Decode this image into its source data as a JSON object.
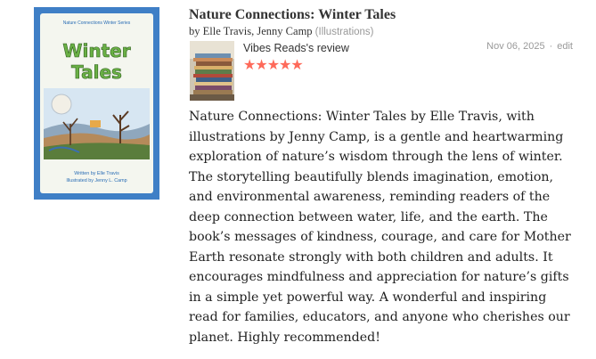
{
  "cover": {
    "series": "Nature Connections Winter Series",
    "title_line1": "Winter",
    "title_line2": "Tales",
    "credit_written": "Written by Elle Travis",
    "credit_illustrated": "Illustrated by Jenny L. Camp"
  },
  "book": {
    "title": "Nature Connections: Winter Tales",
    "authors_prefix": "by Elle Travis, Jenny Camp",
    "illustrator_role": "(Illustrations)"
  },
  "review": {
    "reviewer_label": "Vibes Reads's review",
    "date": "Nov 06, 2025",
    "separator": "·",
    "edit_label": "edit",
    "rating": 5,
    "star_glyph": "★",
    "star_color": "#fe6a5a",
    "body": "Nature Connections: Winter Tales by Elle Travis, with illustrations by Jenny Camp, is a gentle and heartwarming exploration of nature’s wisdom through the lens of winter. The storytelling beautifully blends imagination, emotion, and environmental awareness, reminding readers of the deep connection between water, life, and the earth. The book’s messages of kindness, courage, and care for Mother Earth resonate strongly with both children and adults. It encourages mindfulness and appreciation for nature’s gifts in a simple yet powerful way. A wonderful and inspiring read for families, educators, and anyone who cherishes our planet. Highly recommended!"
  }
}
